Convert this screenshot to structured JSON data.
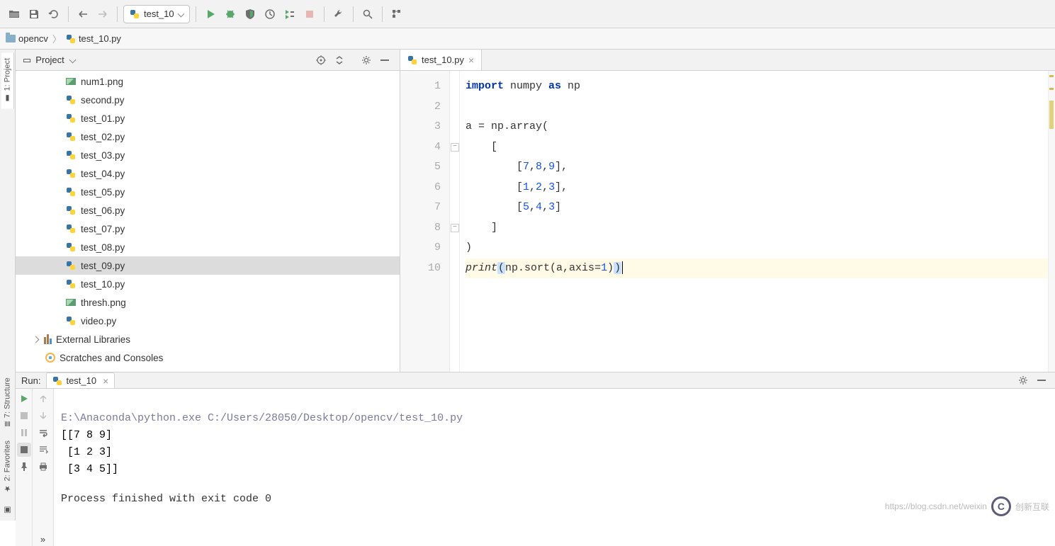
{
  "toolbar": {
    "run_config": "test_10"
  },
  "breadcrumb": {
    "project": "opencv",
    "file": "test_10.py"
  },
  "project_panel": {
    "title": "Project",
    "files": [
      {
        "name": "num1.png",
        "type": "img"
      },
      {
        "name": "second.py",
        "type": "py"
      },
      {
        "name": "test_01.py",
        "type": "py"
      },
      {
        "name": "test_02.py",
        "type": "py"
      },
      {
        "name": "test_03.py",
        "type": "py"
      },
      {
        "name": "test_04.py",
        "type": "py"
      },
      {
        "name": "test_05.py",
        "type": "py"
      },
      {
        "name": "test_06.py",
        "type": "py"
      },
      {
        "name": "test_07.py",
        "type": "py"
      },
      {
        "name": "test_08.py",
        "type": "py"
      },
      {
        "name": "test_09.py",
        "type": "py",
        "selected": true
      },
      {
        "name": "test_10.py",
        "type": "py"
      },
      {
        "name": "thresh.png",
        "type": "img"
      },
      {
        "name": "video.py",
        "type": "py"
      }
    ],
    "external_libraries": "External Libraries",
    "scratches": "Scratches and Consoles"
  },
  "editor": {
    "tab_name": "test_10.py",
    "lines": {
      "l1_kw1": "import",
      "l1_mid": " numpy ",
      "l1_kw2": "as",
      "l1_end": " np",
      "l3": "a = np.array(",
      "l4": "    [",
      "l5a": "        [",
      "l5n1": "7",
      "l5c1": ",",
      "l5n2": "8",
      "l5c2": ",",
      "l5n3": "9",
      "l5b": "],",
      "l6a": "        [",
      "l6n1": "1",
      "l6c1": ",",
      "l6n2": "2",
      "l6c2": ",",
      "l6n3": "3",
      "l6b": "],",
      "l7a": "        [",
      "l7n1": "5",
      "l7c1": ",",
      "l7n2": "4",
      "l7c2": ",",
      "l7n3": "3",
      "l7b": "]",
      "l8": "    ]",
      "l9": ")",
      "l10a": "print",
      "l10p1": "(",
      "l10b": "np.sort(a,",
      "l10kw": "axis",
      "l10c": "=",
      "l10n": "1",
      "l10p2": ")",
      "l10p3": ")"
    }
  },
  "run": {
    "label": "Run:",
    "tab": "test_10",
    "cmd": "E:\\Anaconda\\python.exe C:/Users/28050/Desktop/opencv/test_10.py",
    "out1": "[[7 8 9]",
    "out2": " [1 2 3]",
    "out3": " [3 4 5]]",
    "proc": "Process finished with exit code 0"
  },
  "side_tabs": {
    "project": "1: Project",
    "structure": "7: Structure",
    "favorites": "2: Favorites"
  },
  "watermark": {
    "url": "https://blog.csdn.net/weixin",
    "brand": "创新互联"
  }
}
